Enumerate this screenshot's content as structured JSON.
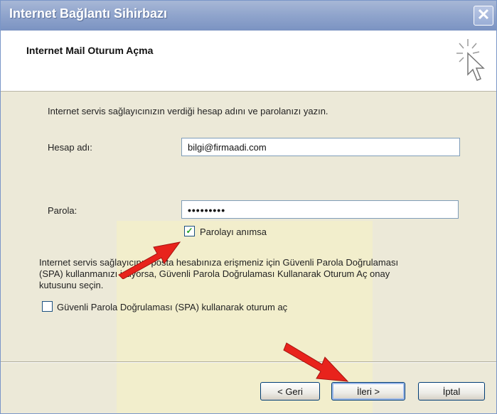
{
  "window": {
    "title": "Internet Bağlantı Sihirbazı",
    "close_glyph": "✕"
  },
  "header": {
    "title": "Internet Mail Oturum Açma"
  },
  "content": {
    "description": "Internet servis sağlayıcınızın verdiği hesap adını ve parolanızı yazın.",
    "account": {
      "label": "Hesap adı:",
      "value": "bilgi@firmaadi.com"
    },
    "password": {
      "label": "Parola:",
      "value": "•••••••••"
    },
    "remember_password": {
      "label": "Parolayı anımsa",
      "checked": true,
      "check_glyph": "✓"
    },
    "spa_info": {
      "line1": "Internet servis sağlayıcınız posta hesabınıza erişmeniz için Güvenli Parola Doğrulaması",
      "line2": "(SPA) kullanmanızı istiyorsa, Güvenli Parola Doğrulaması Kullanarak Oturum Aç onay",
      "line3": "kutusunu seçin."
    },
    "spa_checkbox": {
      "label": "Güvenli Parola Doğrulaması (SPA) kullanarak oturum aç",
      "checked": false
    }
  },
  "buttons": {
    "back": "< Geri",
    "next": "İleri >",
    "cancel": "İptal"
  },
  "annotation_colors": {
    "arrow": "#e8231c"
  },
  "icons": [
    "wizard-cursor-icon",
    "close-icon",
    "red-arrow-icon"
  ]
}
